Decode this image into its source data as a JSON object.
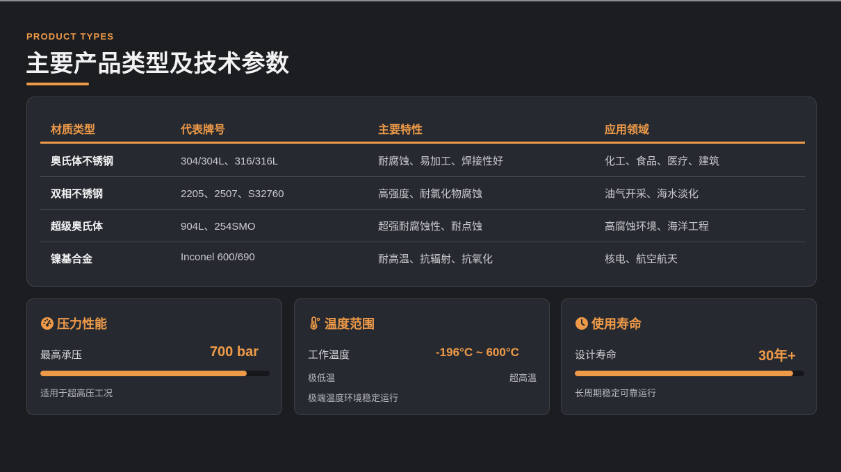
{
  "header": {
    "eyebrow": "PRODUCT TYPES",
    "title": "主要产品类型及技术参数"
  },
  "table": {
    "columns": [
      "材质类型",
      "代表牌号",
      "主要特性",
      "应用领域"
    ],
    "rows": [
      [
        "奥氏体不锈钢",
        "304/304L、316/316L",
        "耐腐蚀、易加工、焊接性好",
        "化工、食品、医疗、建筑"
      ],
      [
        "双相不锈钢",
        "2205、2507、S32760",
        "高强度、耐氯化物腐蚀",
        "油气开采、海水淡化"
      ],
      [
        "超级奥氏体",
        "904L、254SMO",
        "超强耐腐蚀性、耐点蚀",
        "高腐蚀环境、海洋工程"
      ],
      [
        "镍基合金",
        "Inconel 600/690",
        "耐高温、抗辐射、抗氧化",
        "核电、航空航天"
      ]
    ]
  },
  "cards": {
    "pressure": {
      "icon": "gauge-icon",
      "title": "压力性能",
      "label": "最高承压",
      "value": "700 bar",
      "progress": 0.9,
      "note": "适用于超高压工况"
    },
    "temperature": {
      "icon": "thermometer-icon",
      "title": "温度范围",
      "label": "工作温度",
      "value": "-196°C ~ 600°C",
      "low_label": "极低温",
      "high_label": "超高温",
      "note": "极端温度环境稳定运行"
    },
    "lifespan": {
      "icon": "clock-icon",
      "title": "使用寿命",
      "label": "设计寿命",
      "value": "30年+",
      "progress": 0.95,
      "note": "长周期稳定可靠运行"
    }
  },
  "colors": {
    "accent": "#ef9a48",
    "background": "#1b1d20",
    "card": "#262a30"
  }
}
